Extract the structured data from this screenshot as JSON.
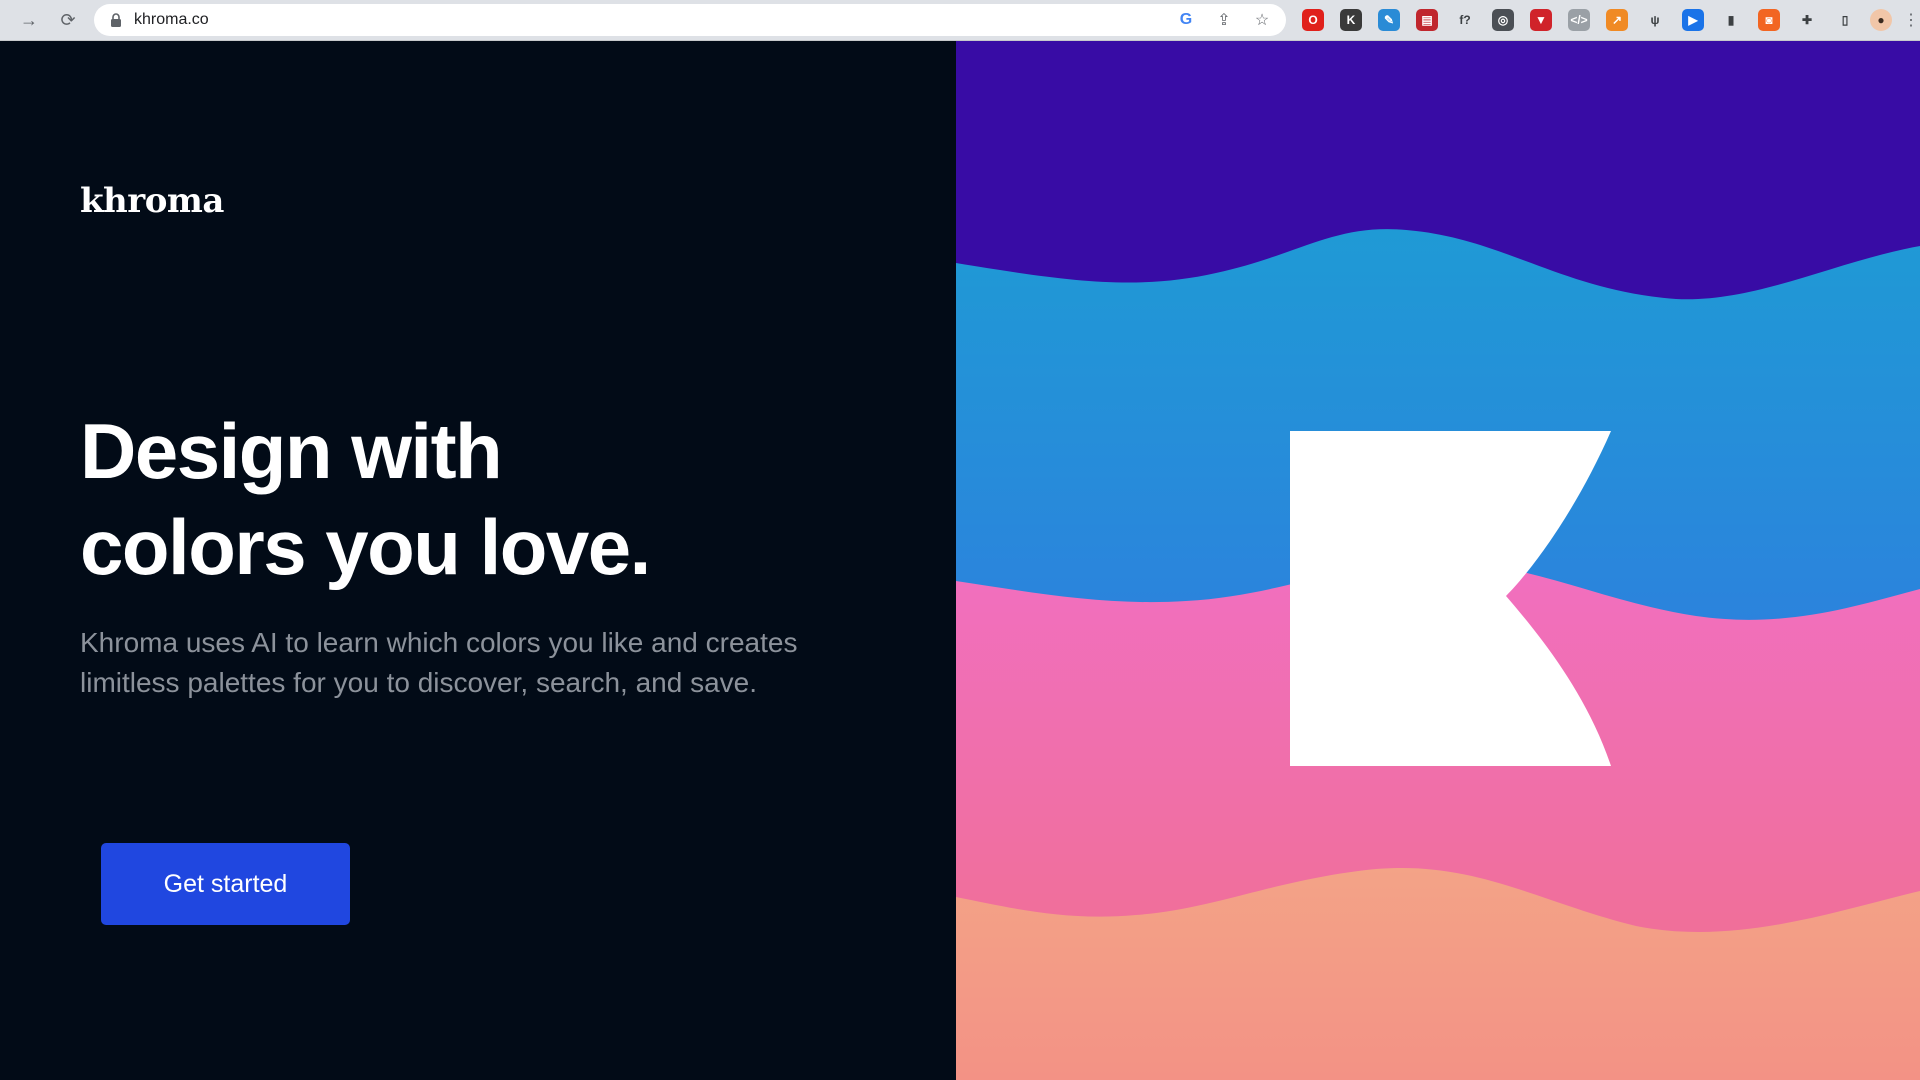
{
  "browser": {
    "url": "khroma.co",
    "extensions": [
      {
        "name": "opera-icon",
        "color": "#e0201b",
        "glyph": "O"
      },
      {
        "name": "k-extension-icon",
        "color": "#3a3a3a",
        "glyph": "K"
      },
      {
        "name": "eyedropper-icon",
        "color": "#2a8bd6",
        "glyph": "✎"
      },
      {
        "name": "chart-extension-icon",
        "color": "#c0262d",
        "glyph": "▤"
      },
      {
        "name": "fonts-extension-icon",
        "color": "#dee1e6",
        "glyph": "f?"
      },
      {
        "name": "target-extension-icon",
        "color": "#4b4f55",
        "glyph": "◎"
      },
      {
        "name": "dislike-extension-icon",
        "color": "#d0232a",
        "glyph": "▼"
      },
      {
        "name": "code-extension-icon",
        "color": "#9aa0a6",
        "glyph": "</>"
      },
      {
        "name": "trend-extension-icon",
        "color": "#f08a24",
        "glyph": "↗"
      },
      {
        "name": "plant-extension-icon",
        "color": "#dee1e6",
        "glyph": "ψ"
      },
      {
        "name": "record-extension-icon",
        "color": "#1a73e8",
        "glyph": "▶"
      },
      {
        "name": "bookmark-extension-icon",
        "color": "#dee1e6",
        "glyph": "▮"
      },
      {
        "name": "video-extension-icon",
        "color": "#f26522",
        "glyph": "◙"
      },
      {
        "name": "puzzle-icon",
        "color": "#dee1e6",
        "glyph": "✚"
      },
      {
        "name": "side-panel-icon",
        "color": "#dee1e6",
        "glyph": "▯"
      }
    ]
  },
  "page": {
    "logo": "khroma",
    "headline_line1": "Design with",
    "headline_line2": "colors you love.",
    "subcopy": "Khroma uses AI to learn which colors you like and creates limitless palettes for you to discover, search, and save.",
    "cta_label": "Get started"
  },
  "colors": {
    "background": "#020b17",
    "cta": "#2047e0",
    "wave_purple": "#380ca5",
    "wave_blue_top": "#1f9ad5",
    "wave_blue_bottom": "#3a68e6",
    "wave_pink": "#f16fc0",
    "wave_rose": "#ef6f8a",
    "wave_peach": "#f3a387"
  }
}
